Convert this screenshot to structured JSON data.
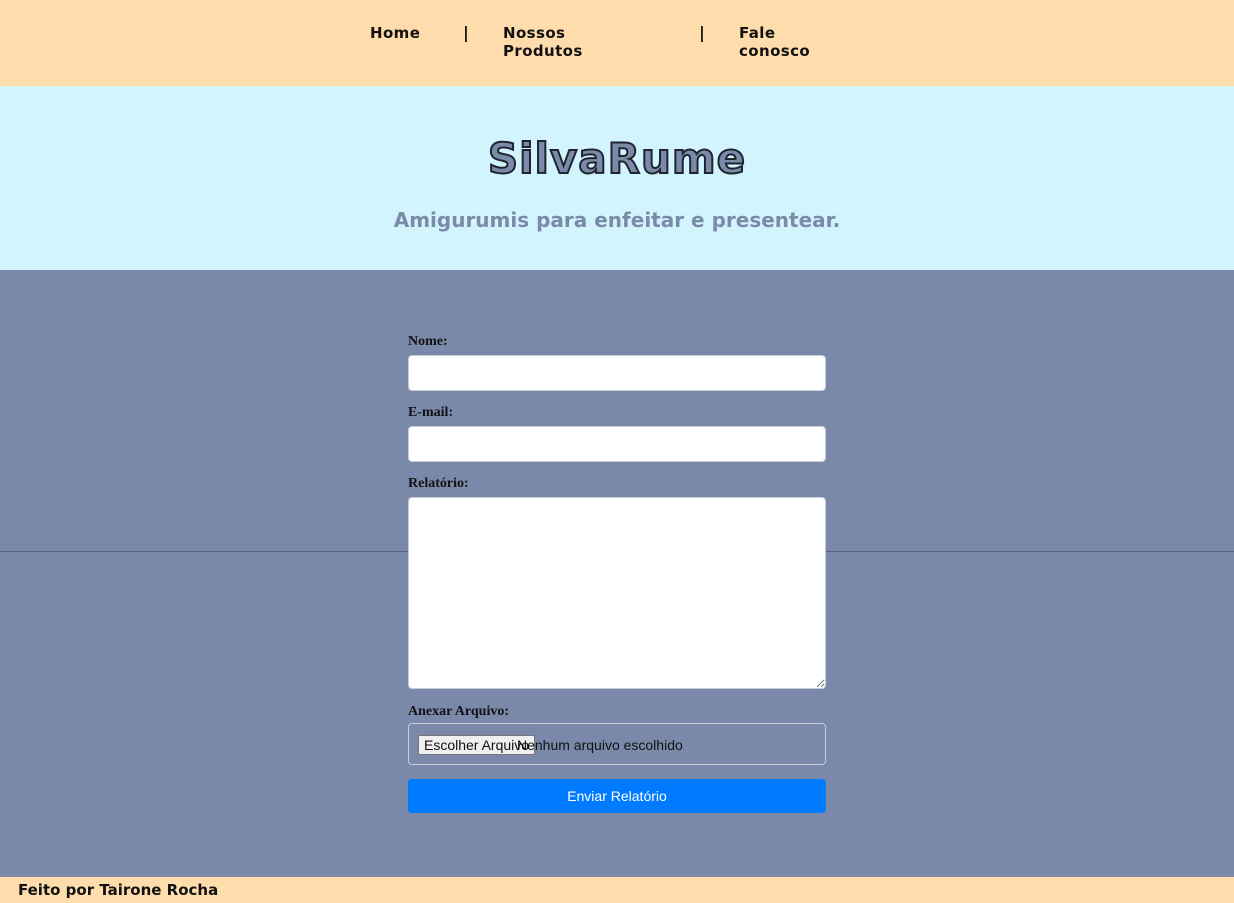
{
  "nav": {
    "home": "Home",
    "separator": "|",
    "produtos": "Nossos Produtos",
    "fale": "Fale conosco"
  },
  "hero": {
    "title": "SilvaRume",
    "subtitle": "Amigurumis para enfeitar e presentear."
  },
  "form": {
    "nome_label": "Nome:",
    "nome_value": "",
    "email_label": "E-mail:",
    "email_value": "",
    "relatorio_label": "Relatório:",
    "relatorio_value": "",
    "anexo_label": "Anexar Arquivo:",
    "file_button": "Escolher Arquivo",
    "file_status": "Nenhum arquivo escolhido",
    "submit_label": "Enviar Relatório"
  },
  "footer": {
    "author": "Feito por Tairone Rocha"
  },
  "colors": {
    "nav_background": "#ffdcab",
    "hero_background": "#d2f5fd",
    "main_background": "#7a89a9",
    "accent": "#007bff",
    "brand_text": "#7a8aa9"
  }
}
